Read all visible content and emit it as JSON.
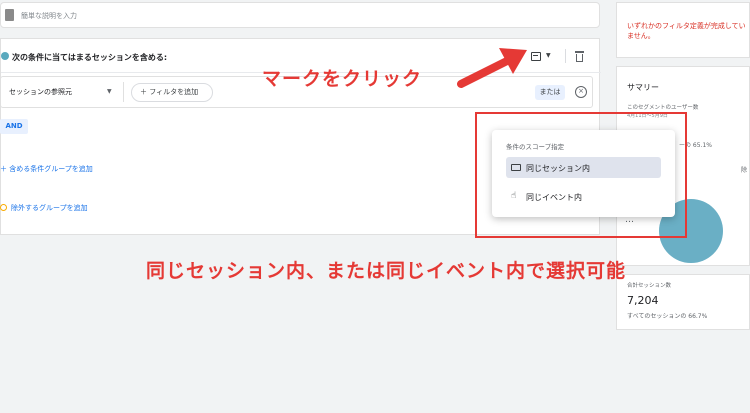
{
  "description_bar": {
    "placeholder": "簡単な説明を入力"
  },
  "condition_group": {
    "title": "次の条件に当てはまるセッションを含める:",
    "filter_row": {
      "dimension": "セッションの参照元",
      "add_filter_label": "＋ フィルタを追加",
      "or_label": "または"
    },
    "and_label": "AND",
    "include_group_link": "＋ 含める条件グループを追加",
    "exclude_group_link": "除外するグループを追加"
  },
  "scope_menu": {
    "header": "条件のスコープ指定",
    "options": [
      {
        "label": "同じセッション内",
        "selected": true,
        "icon": "card-icon"
      },
      {
        "label": "同じイベント内",
        "selected": false,
        "icon": "touch-icon"
      }
    ]
  },
  "right_panel": {
    "alert": "いずれかのフィルタ定義が完成していません。",
    "summary_title": "サマリー",
    "users_label": "このセグメントのユーザー数",
    "date_range": "4月11日～5月9日",
    "pct_fragment": "ーの 65.1%",
    "right_fragment": "除",
    "number_fragment": "…",
    "total_sessions_label": "合計セッション数",
    "total_sessions_value": "7,204",
    "total_sessions_pct": "すべてのセッションの 66.7%"
  },
  "annotations": {
    "click_mark": "マークをクリック",
    "scope_note": "同じセッション内、または同じイベント内で選択可能"
  },
  "colors": {
    "annotation_red": "#e53935",
    "accent_blue": "#1a73e8",
    "teal": "#5aa9be",
    "alert_red": "#d93025"
  }
}
